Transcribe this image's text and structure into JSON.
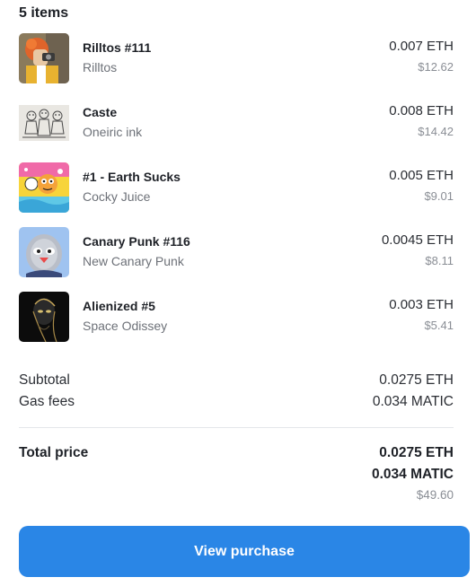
{
  "header": {
    "item_count": "5 items"
  },
  "items": [
    {
      "name": "Rilltos #111",
      "collection": "Rilltos",
      "eth": "0.007 ETH",
      "usd": "$12.62",
      "thumb": "rilltos-art"
    },
    {
      "name": "Caste",
      "collection": "Oneiric ink",
      "eth": "0.008 ETH",
      "usd": "$14.42",
      "thumb": "ink-sketch-art"
    },
    {
      "name": "#1 - Earth Sucks",
      "collection": "Cocky Juice",
      "eth": "0.005 ETH",
      "usd": "$9.01",
      "thumb": "colorful-cartoon-art"
    },
    {
      "name": "Canary Punk #116",
      "collection": "New Canary Punk",
      "eth": "0.0045 ETH",
      "usd": "$8.11",
      "thumb": "canary-bird-art"
    },
    {
      "name": "Alienized #5",
      "collection": "Space Odissey",
      "eth": "0.003 ETH",
      "usd": "$5.41",
      "thumb": "dark-alien-art"
    }
  ],
  "summary": {
    "subtotal_label": "Subtotal",
    "subtotal_value": "0.0275 ETH",
    "gas_label": "Gas fees",
    "gas_value": "0.034 MATIC"
  },
  "total": {
    "label": "Total price",
    "eth": "0.0275 ETH",
    "matic": "0.034 MATIC",
    "usd": "$49.60"
  },
  "actions": {
    "view_purchase": "View purchase"
  },
  "colors": {
    "primary_button": "#2a86e6"
  }
}
